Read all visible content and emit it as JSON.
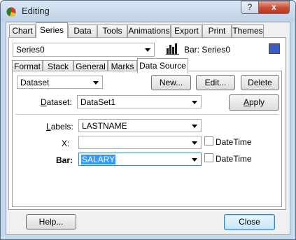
{
  "window": {
    "title": "Editing"
  },
  "titlebar_buttons": {
    "help": "?",
    "close": "x"
  },
  "main_tabs": [
    {
      "label": "Chart"
    },
    {
      "label": "Series"
    },
    {
      "label": "Data"
    },
    {
      "label": "Tools"
    },
    {
      "label": "Animations"
    },
    {
      "label": "Export"
    },
    {
      "label": "Print"
    },
    {
      "label": "Themes"
    }
  ],
  "active_main_tab": "Series",
  "series_selector": {
    "value": "Series0",
    "info_label": "Bar: Series0",
    "color": "#3a5ec8"
  },
  "sub_tabs": [
    {
      "label": "Format"
    },
    {
      "label": "Stack"
    },
    {
      "label": "General"
    },
    {
      "label": "Marks"
    },
    {
      "label": "Data Source"
    }
  ],
  "active_sub_tab": "Data Source",
  "datasource": {
    "type_value": "Dataset",
    "new_label": "New...",
    "edit_label": "Edit...",
    "delete_label": "Delete",
    "dataset_label": "Dataset:",
    "dataset_value": "DataSet1",
    "apply_label": "Apply"
  },
  "fields": {
    "labels_label": "Labels:",
    "labels_value": "LASTNAME",
    "x_label": "X:",
    "x_value": "",
    "bar_label": "Bar:",
    "bar_value": "SALARY",
    "datetime_label": "DateTime"
  },
  "footer": {
    "help_label": "Help...",
    "close_label": "Close"
  }
}
